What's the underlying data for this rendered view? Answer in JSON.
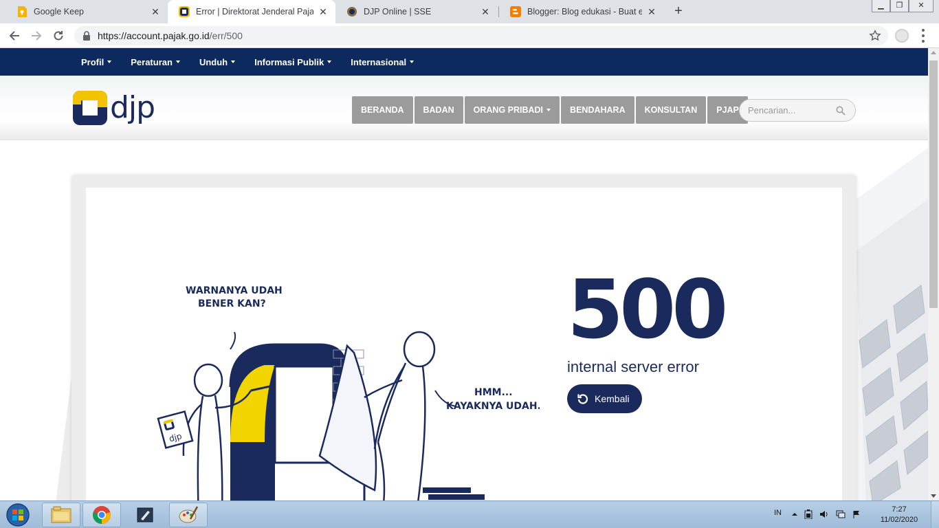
{
  "browser": {
    "tabs": [
      {
        "title": "Google Keep",
        "icon": "keep-icon",
        "active": false
      },
      {
        "title": "Error | Direktorat Jenderal Pajak",
        "icon": "djp-icon",
        "active": true
      },
      {
        "title": "DJP Online | SSE",
        "icon": "djp-online-icon",
        "active": false
      },
      {
        "title": "Blogger: Blog edukasi - Buat entri",
        "icon": "blogger-icon",
        "active": false
      }
    ],
    "url_host": "https://account.pajak.go.id",
    "url_path": "/err/500"
  },
  "site": {
    "topnav": [
      "Profil",
      "Peraturan",
      "Unduh",
      "Informasi Publik",
      "Internasional"
    ],
    "logo_text": "djp",
    "mainnav": [
      {
        "label": "BERANDA",
        "dropdown": false
      },
      {
        "label": "BADAN",
        "dropdown": false
      },
      {
        "label": "ORANG PRIBADI",
        "dropdown": true
      },
      {
        "label": "BENDAHARA",
        "dropdown": false
      },
      {
        "label": "KONSULTAN",
        "dropdown": false
      },
      {
        "label": "PJAP",
        "dropdown": false
      }
    ],
    "search_placeholder": "Pencarian...",
    "colors": {
      "navy": "#1b2a5c",
      "topbar": "#0d2a5e",
      "navbutton": "#9b9b9b",
      "accent_yellow": "#f2c400"
    }
  },
  "error": {
    "code": "500",
    "message": "internal server error",
    "button_label": "Kembali"
  },
  "illustration": {
    "speech_left_line1": "WARNANYA UDAH",
    "speech_left_line2": "BENER KAN?",
    "speech_right_line1": "HMM...",
    "speech_right_line2": "KAYAKNYA UDAH...",
    "card_label": "djp"
  },
  "taskbar": {
    "language": "IN",
    "time": "7:27",
    "date": "11/02/2020"
  }
}
